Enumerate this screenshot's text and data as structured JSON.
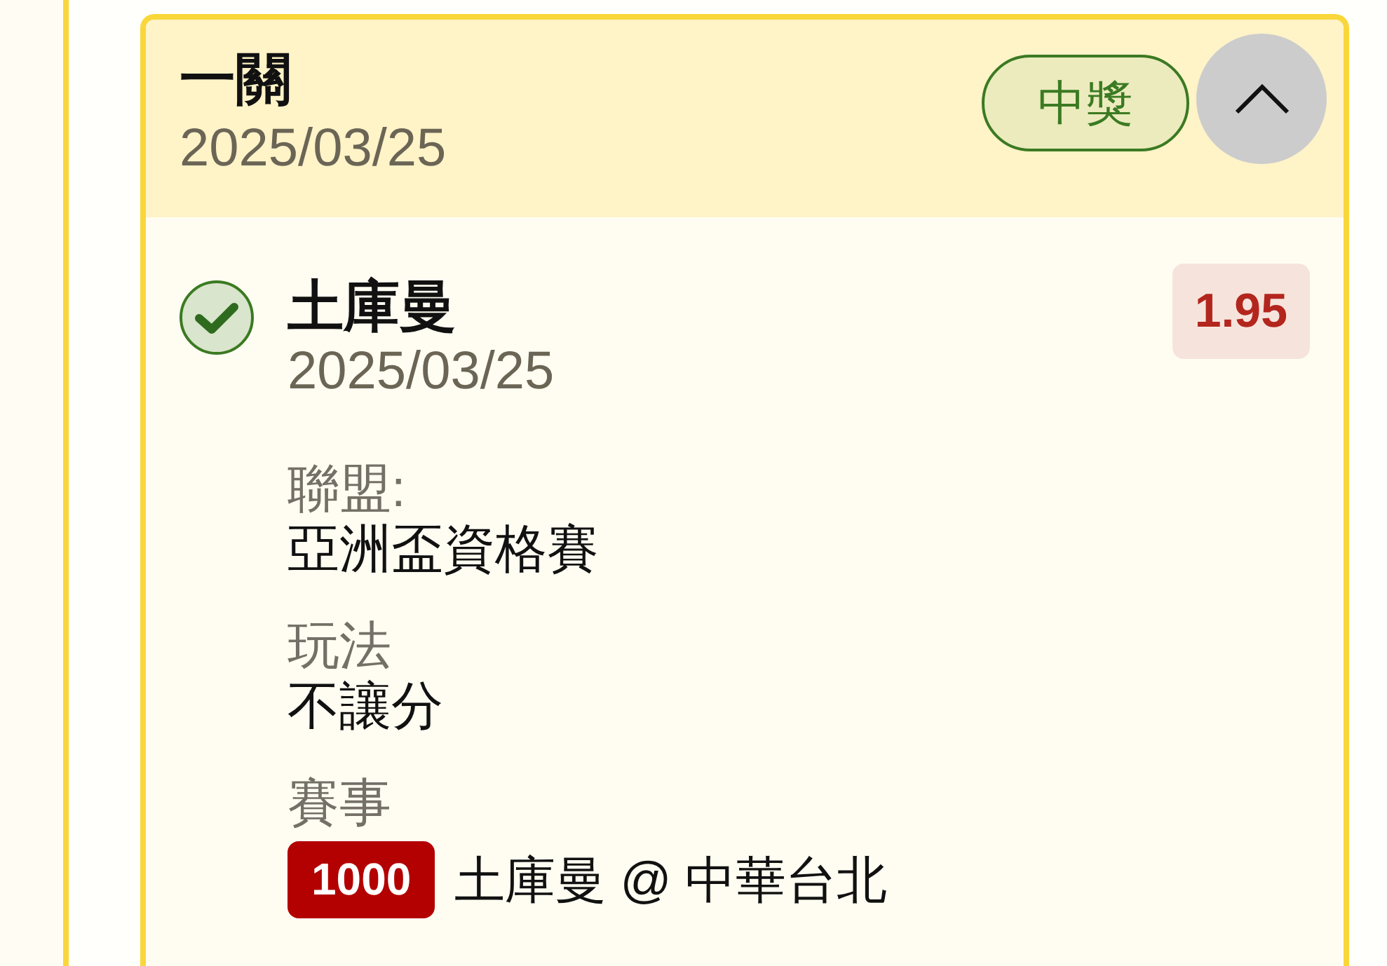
{
  "bet": {
    "title": "一關",
    "date": "2025/03/25",
    "status": {
      "label": "中獎",
      "kind": "won"
    },
    "expanded": true,
    "selections": [
      {
        "team": "土庫曼",
        "date": "2025/03/25",
        "odds": "1.95",
        "checked": true,
        "fields": [
          {
            "kind": "text",
            "label": "聯盟:",
            "value": "亞洲盃資格賽"
          },
          {
            "kind": "text",
            "label": "玩法",
            "value": "不讓分"
          },
          {
            "kind": "match",
            "label": "賽事",
            "badge": "1000",
            "value": "土庫曼 @ 中華台北"
          }
        ]
      }
    ]
  }
}
